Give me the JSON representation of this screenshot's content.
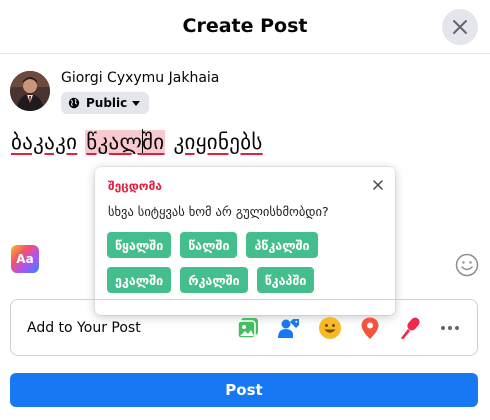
{
  "dialog": {
    "title": "Create Post",
    "close_icon": "close-icon"
  },
  "user": {
    "name": "Giorgi Cyxymu Jakhaia",
    "audience": "Public",
    "audience_icon": "globe-icon",
    "dropdown_icon": "caret-down-icon"
  },
  "composer": {
    "word_1": "ბაკაკი",
    "word_2_before_caret": "წკალ",
    "word_2_after_caret": "ში",
    "word_3": "კიყინებს"
  },
  "spellcheck": {
    "title": "შეცდომა",
    "question": "სხვა სიტყვას ხომ არ გულისხმობდი?",
    "suggestions": [
      "წყალში",
      "წალში",
      "პწკალში",
      "ეკალში",
      "რკალში",
      "წკაპში"
    ],
    "close_icon": "close-icon"
  },
  "background_toggle": {
    "label": "Aa"
  },
  "add_to_post": {
    "label": "Add to Your Post",
    "icons": [
      "photo-icon",
      "tag-people-icon",
      "feeling-icon",
      "location-icon",
      "live-icon",
      "more-icon"
    ]
  },
  "post_button": {
    "label": "Post"
  },
  "colors": {
    "primary": "#1877f2",
    "suggestion_green": "#44be8d",
    "error_red": "#e41e3f",
    "highlight_pink": "#f9c9d0"
  }
}
